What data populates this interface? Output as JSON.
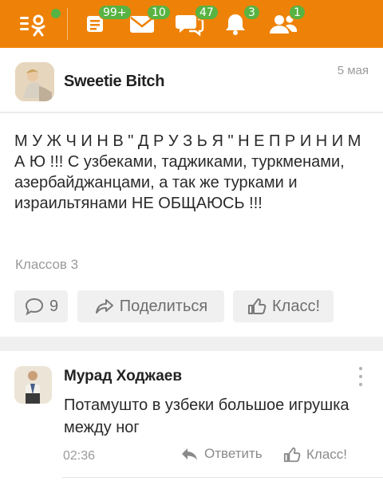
{
  "topbar": {
    "bg_color": "#ee8208",
    "badge_color": "#58b342",
    "items": [
      {
        "icon": "ok-menu-icon",
        "badge": ""
      },
      {
        "icon": "feed-icon",
        "badge": "99+"
      },
      {
        "icon": "envelope-icon",
        "badge": "10"
      },
      {
        "icon": "chat-bubbles-icon",
        "badge": "47"
      },
      {
        "icon": "bell-icon",
        "badge": "3"
      },
      {
        "icon": "friends-icon",
        "badge": "1"
      }
    ]
  },
  "post": {
    "author": "Sweetie Bitch",
    "date": "5 мая",
    "text": "М У Ж Ч И Н В \" Д Р У З Ь Я \" Н Е П Р И Н И М А Ю !!! С узбеками, таджиками, туркменами, азербайджанцами, а так же турками и израильтянами НЕ ОБЩАЮСЬ !!!",
    "classes_label": "Классов 3",
    "comments_count": "9",
    "share_label": "Поделиться",
    "like_label": "Класс!"
  },
  "comment": {
    "author": "Мурад Ходжаев",
    "text": "Потамушто в узбеки большое игрушка между ног",
    "time": "02:36",
    "reply_label": "Ответить",
    "like_label": "Класс!"
  }
}
